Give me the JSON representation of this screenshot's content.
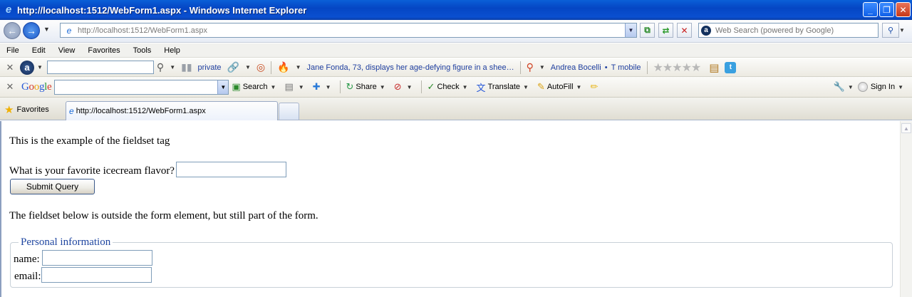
{
  "window": {
    "title": "http://localhost:1512/WebForm1.aspx - Windows Internet Explorer"
  },
  "address_bar": {
    "url": "http://localhost:1512/WebForm1.aspx",
    "search_placeholder": "Web Search (powered by Google)"
  },
  "menu": {
    "items": [
      "File",
      "Edit",
      "View",
      "Favorites",
      "Tools",
      "Help"
    ]
  },
  "ask_toolbar": {
    "private_label": "private",
    "news_link": "Jane Fonda, 73, displays her age-defying figure in a shee…",
    "link_a": "Andrea Bocelli",
    "link_b": "T mobile",
    "separator_dot": "•"
  },
  "google_toolbar": {
    "logo": [
      "G",
      "o",
      "o",
      "g",
      "l",
      "e"
    ],
    "search_label": "Search",
    "share_label": "Share",
    "check_label": "Check",
    "translate_label": "Translate",
    "autofill_label": "AutoFill",
    "sign_in_label": "Sign In"
  },
  "tabs": {
    "favorites_label": "Favorites",
    "active_tab_label": "http://localhost:1512/WebForm1.aspx"
  },
  "page": {
    "intro": "This is the example of the fieldset tag",
    "question": "What is your favorite icecream flavor?",
    "submit_label": "Submit Query",
    "outside_note": "The fieldset below is outside the form element, but still part of the form.",
    "legend": "Personal information",
    "name_label": "name:",
    "email_label": "email:"
  }
}
